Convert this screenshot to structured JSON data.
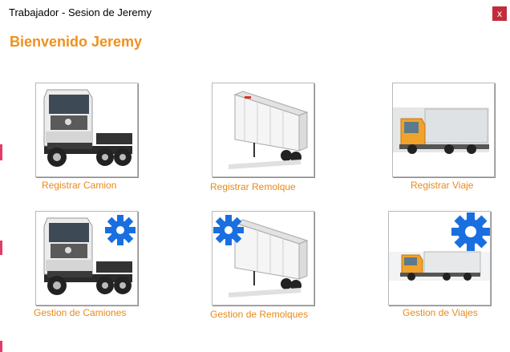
{
  "window": {
    "title": "Trabajador - Sesion de Jeremy",
    "close_label": "x"
  },
  "header": {
    "welcome": "Bienvenido Jeremy"
  },
  "tiles": [
    {
      "label": "Registrar Camion",
      "icon": "truck-cab-icon"
    },
    {
      "label": "Registrar Remolque",
      "icon": "trailer-icon"
    },
    {
      "label": "Registrar Viaje",
      "icon": "cargo-truck-icon"
    },
    {
      "label": "Gestion de Camiones",
      "icon": "truck-cab-gear-icon"
    },
    {
      "label": "Gestion de Remolques",
      "icon": "trailer-gear-icon"
    },
    {
      "label": "Gestion de Viajes",
      "icon": "cargo-truck-gear-icon"
    }
  ],
  "colors": {
    "accent": "#f0901e",
    "gear": "#1a6fe0",
    "close": "#c42b3a"
  }
}
